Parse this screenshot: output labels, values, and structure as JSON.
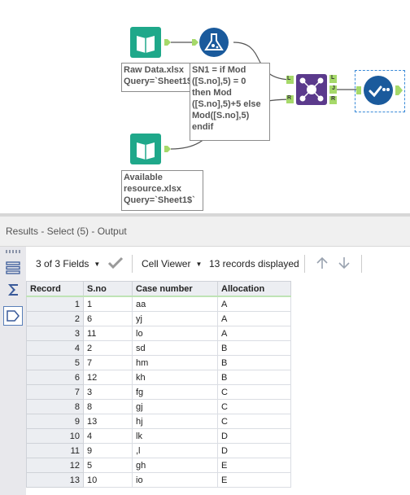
{
  "workflow": {
    "annotations": {
      "input1": [
        "Raw Data.xlsx",
        "Query=`Sheet1$`"
      ],
      "formula": [
        "SN1 = if Mod",
        "([S.no],5) = 0",
        "then Mod",
        "([S.no],5)+5 else",
        "Mod([S.no],5)",
        "endif"
      ],
      "input2": [
        "Available",
        "resource.xlsx",
        "Query=`Sheet1$`"
      ]
    },
    "join_anchors": {
      "left": "L",
      "right": "R",
      "out_left": "L",
      "out_join": "J",
      "out_right": "R"
    }
  },
  "results": {
    "title": "Results - Select (5) - Output",
    "toolbar": {
      "fields": "3 of 3 Fields",
      "viewer": "Cell Viewer",
      "records": "13 records displayed"
    },
    "columns": [
      "Record",
      "S.no",
      "Case number",
      "Allocation"
    ],
    "rows": [
      [
        "1",
        "1",
        "aa",
        "A"
      ],
      [
        "2",
        "6",
        "yj",
        "A"
      ],
      [
        "3",
        "11",
        "lo",
        "A"
      ],
      [
        "4",
        "2",
        "sd",
        "B"
      ],
      [
        "5",
        "7",
        "hm",
        "B"
      ],
      [
        "6",
        "12",
        "kh",
        "B"
      ],
      [
        "7",
        "3",
        "fg",
        "C"
      ],
      [
        "8",
        "8",
        "gj",
        "C"
      ],
      [
        "9",
        "13",
        "hj",
        "C"
      ],
      [
        "10",
        "4",
        "lk",
        "D"
      ],
      [
        "11",
        "9",
        ",l",
        "D"
      ],
      [
        "12",
        "5",
        "gh",
        "E"
      ],
      [
        "13",
        "10",
        "io",
        "E"
      ]
    ]
  },
  "colors": {
    "input_tool": "#1fa88a",
    "formula_tool": "#1a5a9c",
    "join_tool": "#5b3a8c",
    "select_tool": "#1a5a9c",
    "anchor": "#a6d96a",
    "selection_border": "#3a8ad8"
  }
}
